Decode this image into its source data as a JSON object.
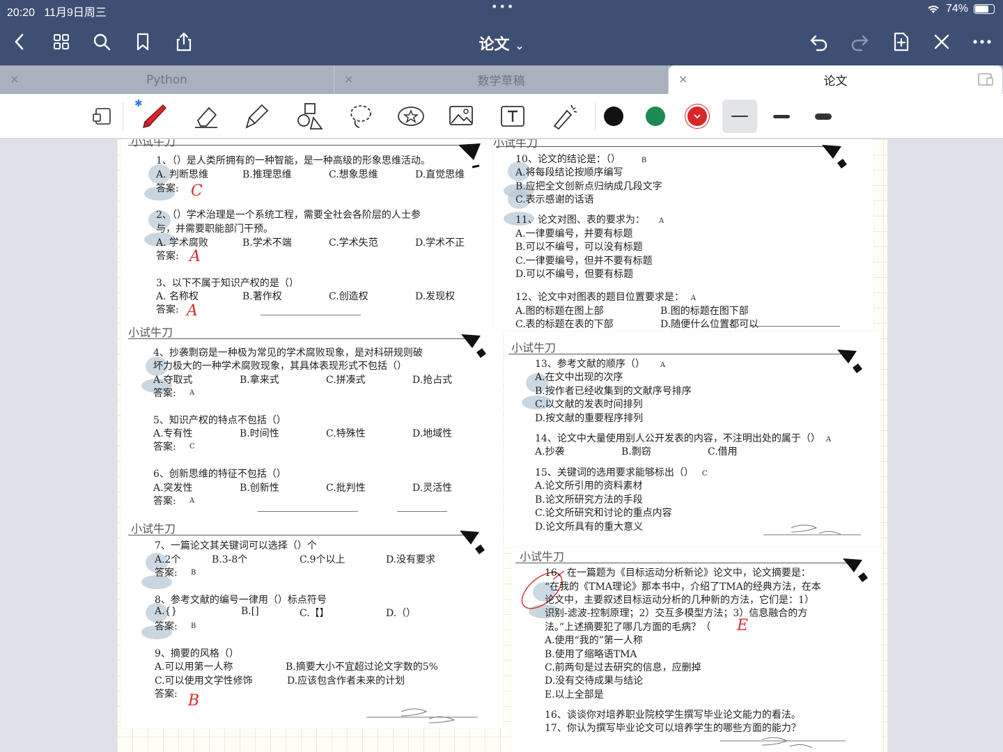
{
  "status": {
    "time": "20:20",
    "date": "11月9日周三",
    "battery": "74%",
    "battery_level": 0.74
  },
  "nav": {
    "title": "论文",
    "title_chevron": "⌄"
  },
  "tabs": [
    {
      "label": "Python",
      "close": "×"
    },
    {
      "label": "数学草稿",
      "close": "×"
    },
    {
      "label": "论文",
      "close": "×"
    }
  ],
  "toolbar": {
    "colors": [
      "#111111",
      "#1c8a52",
      "#d8262a"
    ],
    "bluetooth": "✱"
  },
  "left": {
    "sections": [
      "小试牛刀",
      "小试牛刀",
      "小试牛刀"
    ],
    "q1": {
      "q": "1、（）是人类所拥有的一种智能，是一种高级的形象思维活动。",
      "a": "A. 判断思维",
      "b": "B.推理思维",
      "c": "C.想象思维",
      "d": "D.直觉思维",
      "ans_label": "答案:",
      "ans": "C"
    },
    "q2": {
      "q1": "2、（）学术治理是一个系统工程，需要全社会各阶层的人士参",
      "q2": "与，并需要职能部门干预。",
      "a": "A. 学术腐败",
      "b": "B.学术不端",
      "c": "C.学术失范",
      "d": "D.学术不正",
      "ans_label": "答案:",
      "ans": "A"
    },
    "q3": {
      "q": "3、以下不属于知识产权的是（）",
      "a": "A. 名称权",
      "b": "B.著作权",
      "c": "C.创造权",
      "d": "D.发现权",
      "ans_label": "答案:",
      "ans": "A"
    },
    "q4": {
      "q1": "4、抄袭剽窃是一种极为常见的学术腐败现象，是对科研规则破",
      "q2": "坏力极大的一种学术腐败现象，其具体表现形式不包括（）",
      "a": "A.夺取式",
      "b": "B.拿来式",
      "c": "C.拼凑式",
      "d": "D.抢占式",
      "ans_label": "答案:",
      "ans": "A"
    },
    "q5": {
      "q": "5、知识产权的特点不包括（）",
      "a": "A.专有性",
      "b": "B.时间性",
      "c": "C.特殊性",
      "d": "D.地域性",
      "ans_label": "答案:",
      "ans": "C"
    },
    "q6": {
      "q": "6、创新思维的特征不包括（）",
      "a": "A.突发性",
      "b": "B.创新性",
      "c": "C.批判性",
      "d": "D.灵活性",
      "ans_label": "答案:",
      "ans": "A"
    },
    "q7": {
      "q": "7、一篇论文其关键词可以选择（）个",
      "a": "A.2个",
      "b": "B.3-8个",
      "c": "C.9个以上",
      "d": "D.没有要求",
      "ans_label": "答案:",
      "ans": "B"
    },
    "q8": {
      "q": "8、参考文献的编号一律用（）标点符号",
      "a": "A.{}",
      "b": "B.[]",
      "c": "C.【】",
      "d": "D.（）",
      "ans_label": "答案:",
      "ans": "B"
    },
    "q9": {
      "q": "9、摘要的风格（）",
      "a": "A.可以用第一人称",
      "b": "B.摘要大小不宜超过论文字数的5%",
      "c": "C.可以使用文学性修饰",
      "d": "D.应该包含作者未来的计划",
      "ans_label": "答案:",
      "ans": "B"
    }
  },
  "right": {
    "sections": [
      "小试牛刀",
      "小试牛刀",
      "小试牛刀"
    ],
    "q10": {
      "q": "10、论文的结论是：（）",
      "mark": "B",
      "a": "A.将每段结论按顺序编写",
      "b": "B.应把全文创新点归纳成几段文字",
      "c": "C.表示感谢的话语"
    },
    "q11": {
      "q": "11、论文对图、表的要求为：",
      "mark": "A",
      "a": "A.一律要编号，并要有标题",
      "b": "B.可以不编号，可以没有标题",
      "c": "C.一律要编号，但并不要有标题",
      "d": "D.可以不编号，但要有标题"
    },
    "q12": {
      "q": "12、论文中对图表的题目位置要求是：",
      "mark": "A",
      "a": "A.图的标题在图上部",
      "b": "B.图的标题在图下部",
      "c": "C.表的标题在表的下部",
      "d": "D.随便什么位置都可以"
    },
    "q13": {
      "q": "13、参考文献的顺序（）",
      "mark": "A",
      "a": "A.在文中出现的次序",
      "b": "B.按作者已经收集到的文献序号排序",
      "c": "C.以文献的发表时间排列",
      "d": "D.按文献的重要程序排列"
    },
    "q14": {
      "q": "14、论文中大量使用别人公开发表的内容，不注明出处的属于（）",
      "mark": "A",
      "a": "A.抄袭",
      "b": "B.剽窃",
      "c": "C.借用"
    },
    "q15": {
      "q": "15、关键词的选用要求能够标出（）",
      "mark": "C",
      "a": "A.论文所引用的资料素材",
      "b": "B.论文所研究方法的手段",
      "c": "C.论文所研究和讨论的重点内容",
      "d": "D.论文所具有的重大意义"
    },
    "q16": {
      "l1": "16、在一篇题为《目标运动分析新论》论文中，论文摘要是：",
      "l2": "“在我的《TMA理论》那本书中，介绍了TMA的经典方法，在本",
      "l3": "论文中，主要叙述目标运动分析的几种新的方法，它们是：1）",
      "l4": "识别-滤波-控制原理；2）交互多模型方法；3）信息融合的方",
      "l5": "法。”上述摘要犯了哪几方面的毛病？（",
      "hand": "E",
      "a": "A.使用“我的”第一人称",
      "b": "B.使用了缩略语TMA",
      "c": "C.前两句是过去研究的信息，应删掉",
      "d": "D.没有交待成果与结论",
      "e": "E.以上全部是"
    },
    "q17": {
      "l1": "16、谈谈你对培养职业院校学生撰写毕业论文能力的看法。",
      "l2": "17、你认为撰写毕业论文可以培养学生的哪些方面的能力？"
    }
  }
}
